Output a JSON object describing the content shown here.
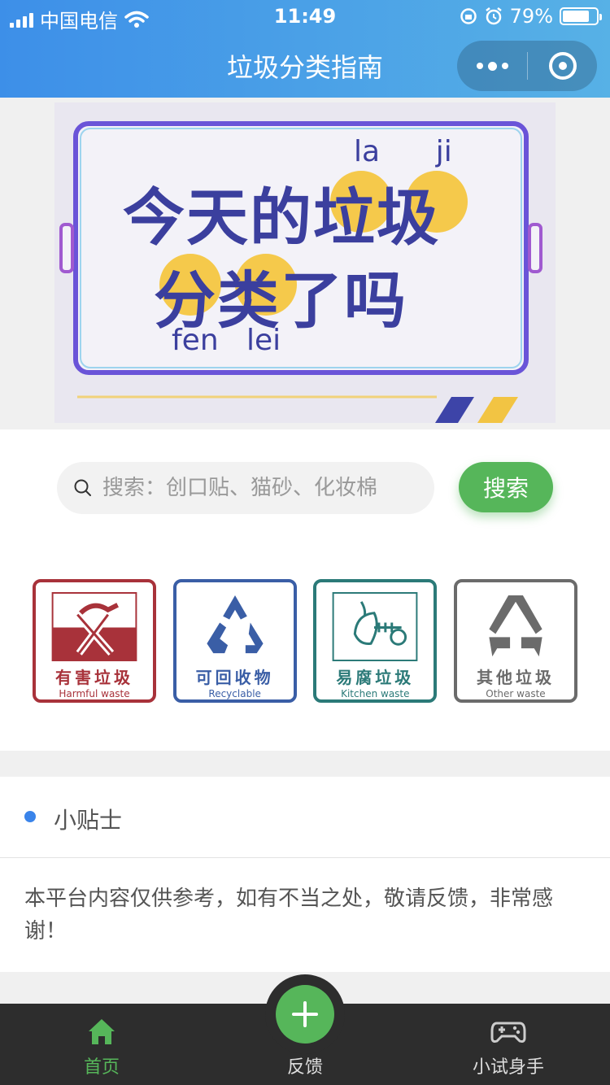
{
  "status_bar": {
    "carrier": "中国电信",
    "time": "11:49",
    "battery_percent": "79%",
    "battery_level": 0.79
  },
  "nav": {
    "title": "垃圾分类指南",
    "capsule_icons": [
      "more-dots-icon",
      "close-target-icon"
    ]
  },
  "banner": {
    "line1_part1": "今天的",
    "line1_part2": "垃圾",
    "line2_part1": "分类",
    "line2_part2": "了吗",
    "pinyin_top": "la      ji",
    "pinyin_bottom": "fen   lei"
  },
  "search": {
    "placeholder": "搜索：创口贴、猫砂、化妆棉",
    "button_label": "搜索"
  },
  "categories": [
    {
      "zh": "有害垃圾",
      "en": "Harmful waste",
      "color": "#a8323a"
    },
    {
      "zh": "可回收物",
      "en": "Recyclable",
      "color": "#3a5ea6"
    },
    {
      "zh": "易腐垃圾",
      "en": "Kitchen waste",
      "color": "#2b7a78"
    },
    {
      "zh": "其他垃圾",
      "en": "Other waste",
      "color": "#6b6b6b"
    }
  ],
  "tips": {
    "title": "小贴士",
    "body": "本平台内容仅供参考，如有不当之处，敬请反馈，非常感谢！"
  },
  "tabbar": {
    "home": "首页",
    "feedback": "反馈",
    "game": "小试身手"
  },
  "colors": {
    "header_start": "#3d8fe8",
    "header_end": "#57b1e6",
    "accent_green": "#56b65a",
    "tip_dot": "#3a84ea",
    "tabbar_bg": "#2d2d2d"
  }
}
